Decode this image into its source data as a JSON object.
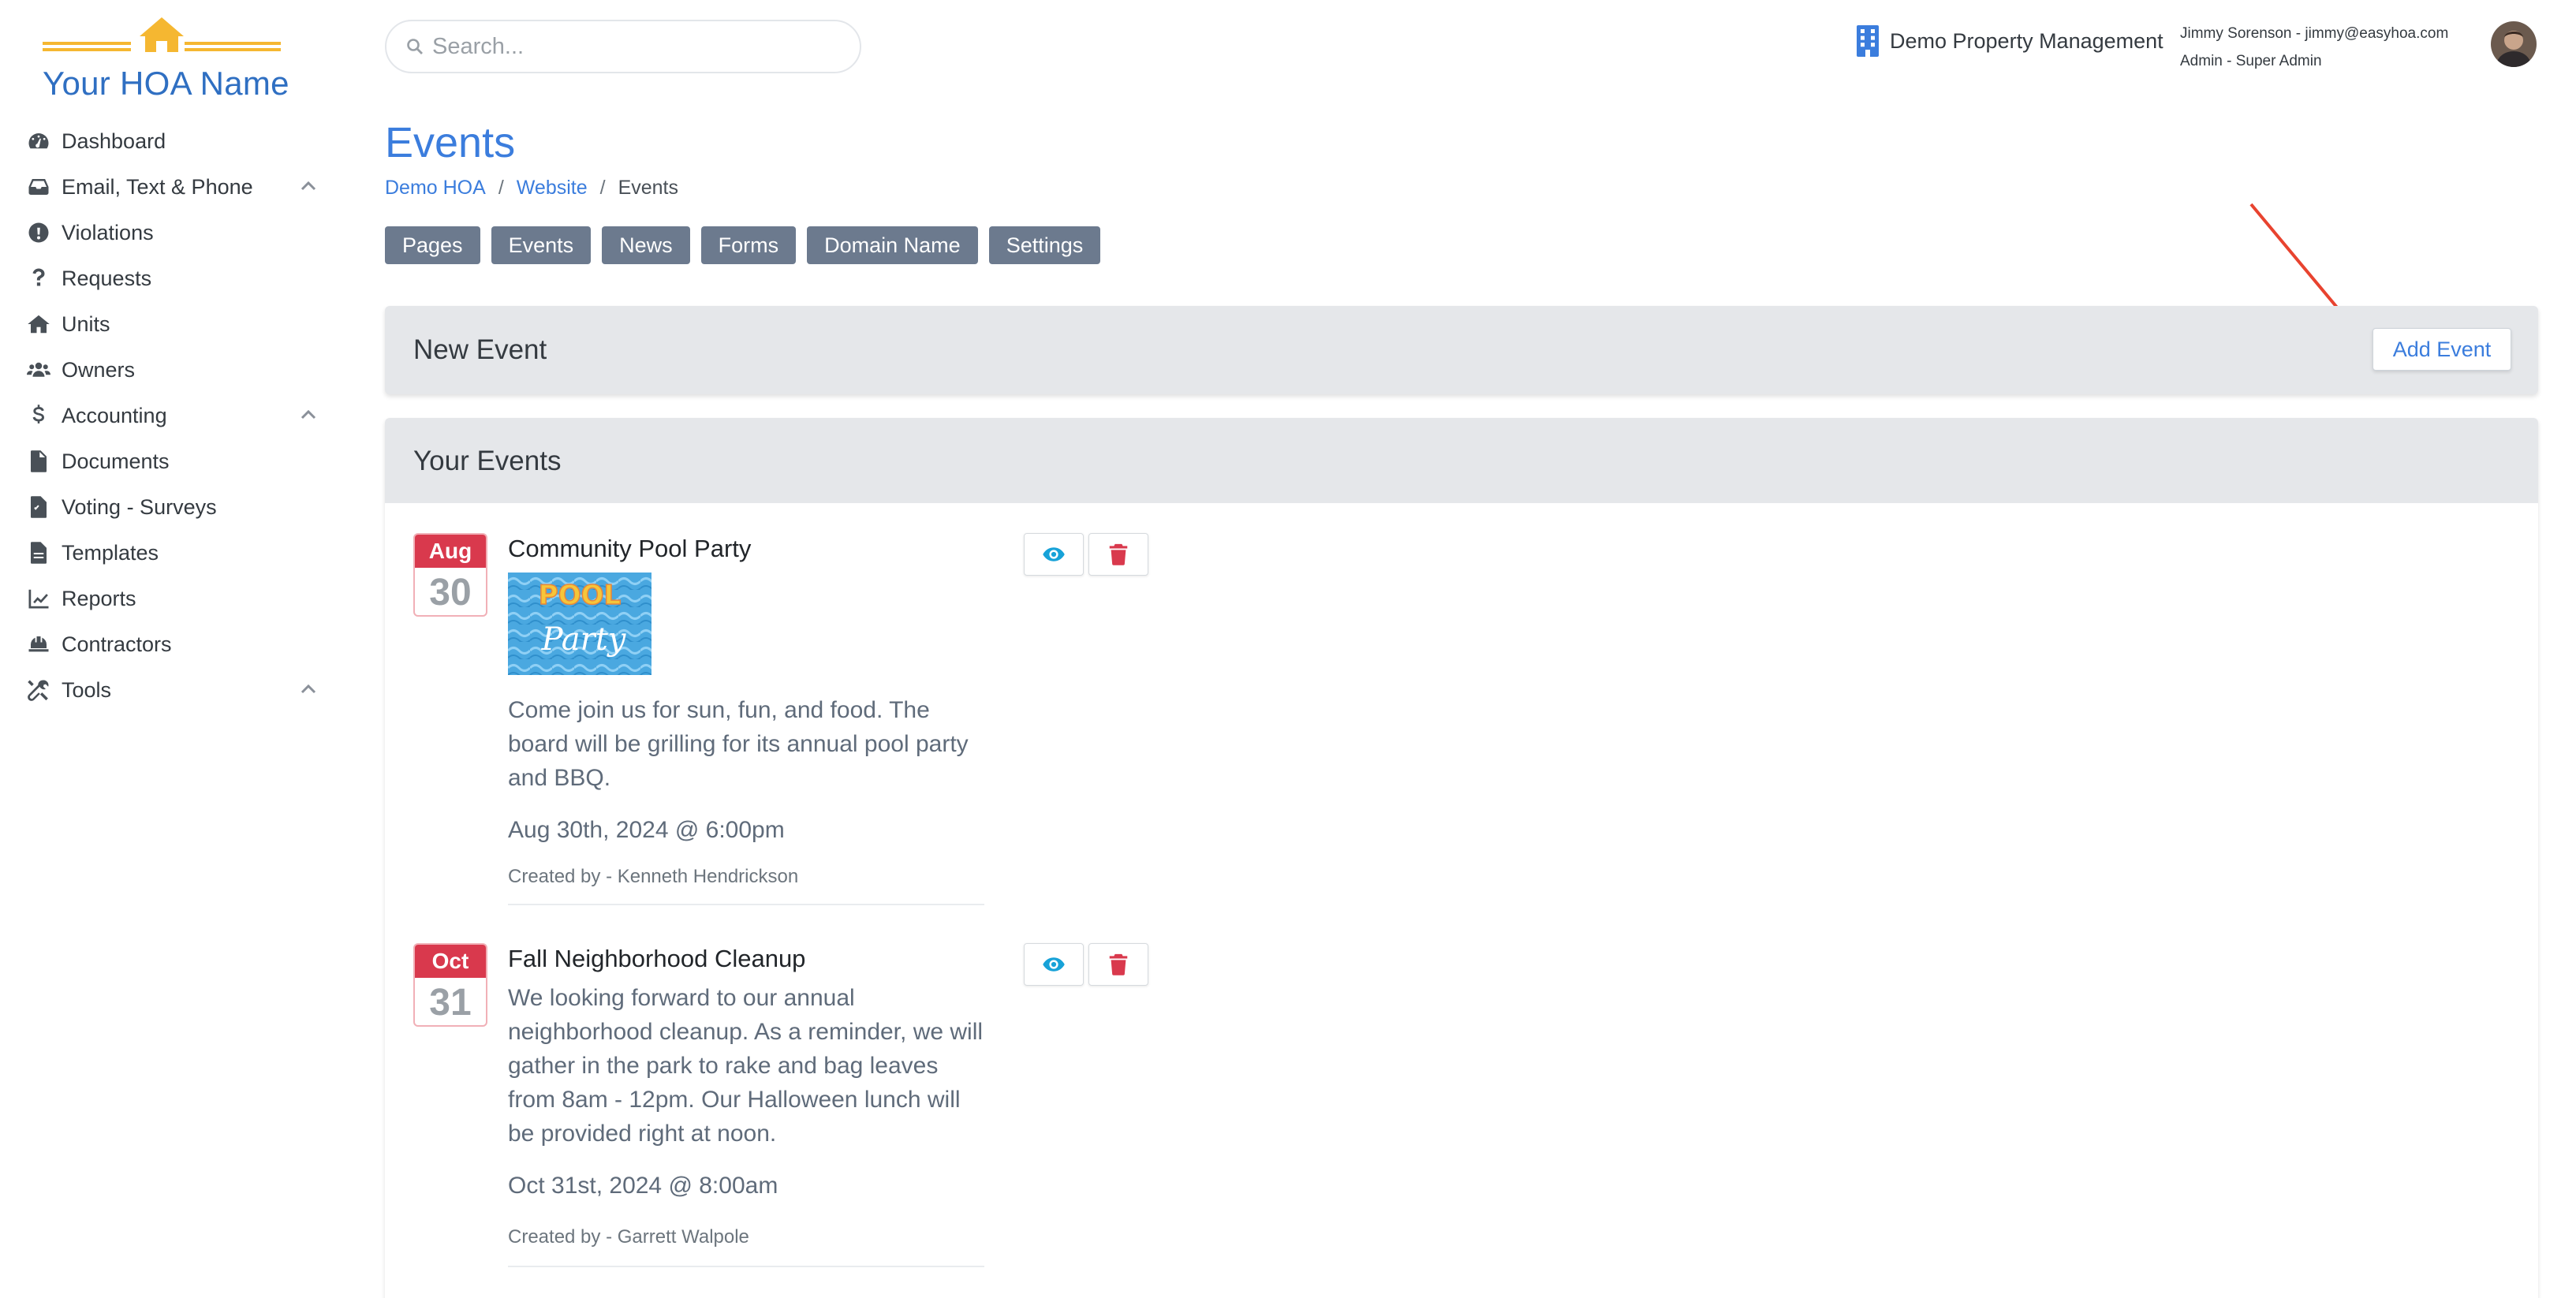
{
  "brand": {
    "name": "Your HOA Name",
    "accent": "#3b7ddd",
    "roof_color": "#f5b731"
  },
  "sidebar": {
    "items": [
      {
        "label": "Dashboard",
        "icon": "dashboard-icon",
        "expandable": false
      },
      {
        "label": "Email, Text & Phone",
        "icon": "inbox-icon",
        "expandable": true
      },
      {
        "label": "Violations",
        "icon": "alert-circle-icon",
        "expandable": false
      },
      {
        "label": "Requests",
        "icon": "question-icon",
        "expandable": false
      },
      {
        "label": "Units",
        "icon": "home-icon",
        "expandable": false
      },
      {
        "label": "Owners",
        "icon": "users-icon",
        "expandable": false
      },
      {
        "label": "Accounting",
        "icon": "dollar-icon",
        "expandable": true
      },
      {
        "label": "Documents",
        "icon": "document-icon",
        "expandable": false
      },
      {
        "label": "Voting - Surveys",
        "icon": "ballot-icon",
        "expandable": false
      },
      {
        "label": "Templates",
        "icon": "template-icon",
        "expandable": false
      },
      {
        "label": "Reports",
        "icon": "chart-line-icon",
        "expandable": false
      },
      {
        "label": "Contractors",
        "icon": "hard-hat-icon",
        "expandable": false
      },
      {
        "label": "Tools",
        "icon": "tools-icon",
        "expandable": true
      }
    ]
  },
  "topbar": {
    "search_placeholder": "Search...",
    "org_name": "Demo Property Management",
    "user_line": "Jimmy Sorenson - jimmy@easyhoa.com",
    "role_line": "Admin - Super Admin"
  },
  "page": {
    "title": "Events",
    "breadcrumb": [
      "Demo HOA",
      "Website",
      "Events"
    ],
    "tabs": [
      "Pages",
      "Events",
      "News",
      "Forms",
      "Domain Name",
      "Settings"
    ]
  },
  "new_event": {
    "title": "New Event",
    "button": "Add Event"
  },
  "events_card": {
    "title": "Your Events",
    "events": [
      {
        "month": "Aug",
        "day": "30",
        "title": "Community Pool Party",
        "image_text": [
          "POOL",
          "Party"
        ],
        "description": "Come join us for sun, fun, and food. The board will be grilling for its annual pool party and BBQ.",
        "datetime": "Aug 30th, 2024 @ 6:00pm",
        "created_by": "Created by - Kenneth Hendrickson"
      },
      {
        "month": "Oct",
        "day": "31",
        "title": "Fall Neighborhood Cleanup",
        "description": "We looking forward to our annual neighborhood cleanup. As a reminder, we will gather in the park to rake and bag leaves from 8am - 12pm. Our Halloween lunch will be provided right at noon.",
        "datetime": "Oct 31st, 2024 @ 8:00am",
        "created_by": "Created by - Garrett Walpole"
      }
    ]
  }
}
